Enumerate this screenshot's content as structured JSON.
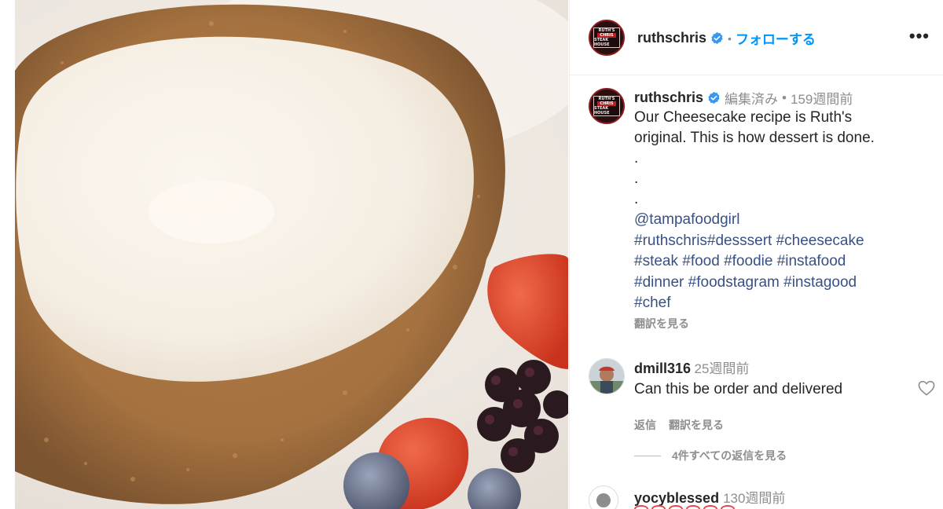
{
  "post": {
    "author": "ruthschris",
    "verified": true,
    "follow_label": "フォローする",
    "separator": "•",
    "more_label": "•••",
    "avatar_logo": {
      "top": "RUTH'S",
      "middle": "CHRIS",
      "bottom": "STEAK HOUSE"
    }
  },
  "caption": {
    "author": "ruthschris",
    "edited_label": "編集済み",
    "time": "159週間前",
    "lines": [
      "Our Cheesecake recipe is Ruth's",
      "original. This is how dessert is done.",
      ".",
      ".",
      "."
    ],
    "tag_lines": [
      "@tampafoodgirl",
      "#ruthschris#desssert #cheesecake",
      "#steak #food #foodie #instafood",
      "#dinner  #foodstagram #instagood",
      "#chef"
    ],
    "translate_label": "翻訳を見る"
  },
  "comments": [
    {
      "author": "dmill316",
      "time": "25週間前",
      "text": "Can this be order and delivered",
      "reply_label": "返信",
      "translate_label": "翻訳を見る",
      "view_replies_label": "4件すべての返信を見る"
    },
    {
      "author": "yocyblessed",
      "time": "130週間前"
    }
  ],
  "colors": {
    "link": "#385185",
    "follow": "#0095f6",
    "verified": "#3897f0",
    "muted": "#8e8e8e"
  },
  "icons": {
    "verified": "verified-badge-icon",
    "more": "more-options-icon",
    "heart": "heart-outline-icon"
  }
}
